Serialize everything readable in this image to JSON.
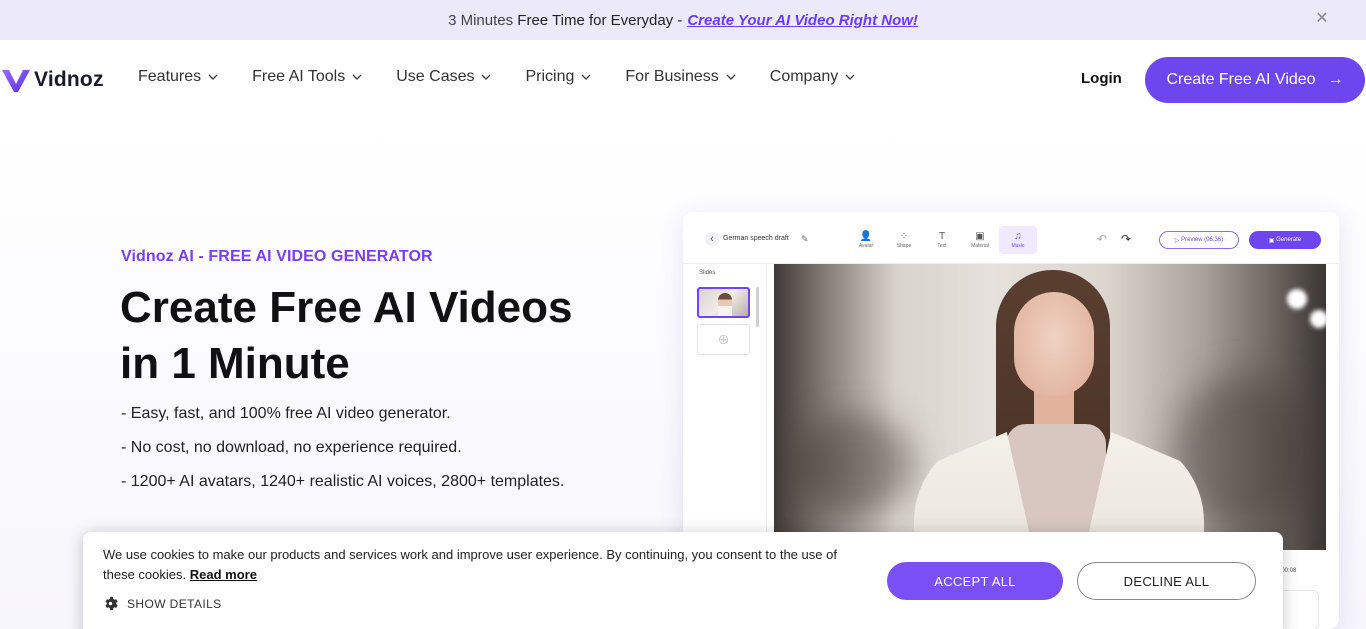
{
  "announcement": {
    "prefix_muted": "3 Minutes",
    "prefix": "Free Time for Everyday -",
    "link": "Create Your AI Video Right Now!"
  },
  "nav": {
    "logo_text": "Vidnoz",
    "menu": [
      "Features",
      "Free AI Tools",
      "Use Cases",
      "Pricing",
      "For Business",
      "Company"
    ],
    "login": "Login",
    "cta": "Create Free AI Video"
  },
  "hero": {
    "eyebrow": "Vidnoz AI - FREE AI VIDEO GENERATOR",
    "headline_line1": "Create Free AI Videos",
    "headline_line2": "in 1 Minute",
    "bullets": [
      "- Easy, fast, and 100% free AI video generator.",
      "- No cost, no download, no experience required.",
      "- 1200+ AI avatars, 1240+ realistic AI voices, 2800+ templates."
    ]
  },
  "editor": {
    "title": "German speech draft",
    "tools": [
      "Avatar",
      "Shape",
      "Text",
      "Material",
      "Music"
    ],
    "preview": "Preview (06:36)",
    "generate": "Generate",
    "slides_label": "Slides",
    "time": "0 / 00:08"
  },
  "cookie": {
    "text": "We use cookies to make our products and services work and improve user experience. By continuing, you consent to the use of these cookies.",
    "read_more": "Read more",
    "show_details": "SHOW DETAILS",
    "accept": "ACCEPT ALL",
    "decline": "DECLINE ALL"
  },
  "colors": {
    "brand": "#6e46f0",
    "announce_bg": "#ece9fb"
  }
}
